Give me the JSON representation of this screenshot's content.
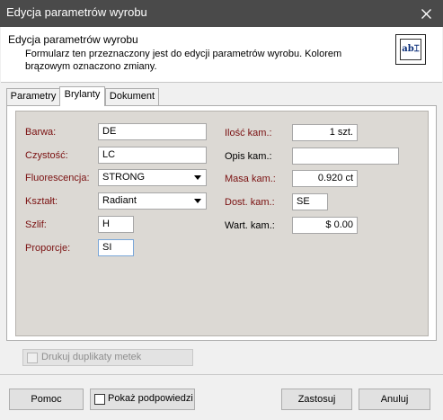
{
  "window": {
    "title": "Edycja parametrów wyrobu"
  },
  "header": {
    "title": "Edycja parametrów wyrobu",
    "description": "Formularz ten przeznaczony jest do edycji parametrów wyrobu. Kolorem brązowym oznaczono zmiany.",
    "icon": "edit-field-icon",
    "icon_text": "ab"
  },
  "tabs": [
    {
      "label": "Parametry",
      "active": false
    },
    {
      "label": "Brylanty",
      "active": true
    },
    {
      "label": "Dokument",
      "active": false
    }
  ],
  "left_fields": [
    {
      "label": "Barwa:",
      "value": "DE"
    },
    {
      "label": "Czystość:",
      "value": "LC"
    },
    {
      "label": "Fluorescencja:",
      "value": "STRONG"
    },
    {
      "label": "Kształt:",
      "value": "Radiant"
    },
    {
      "label": "Szlif:",
      "value": "H"
    },
    {
      "label": "Proporcje:",
      "value": "SI"
    }
  ],
  "right_fields": [
    {
      "label": "Ilość kam.:",
      "value": "1 szt."
    },
    {
      "label": "Opis kam.:",
      "value": ""
    },
    {
      "label": "Masa kam.:",
      "value": "0.920 ct"
    },
    {
      "label": "Dost. kam.:",
      "value": "SE"
    },
    {
      "label": "Wart. kam.:",
      "value": "$ 0.00"
    }
  ],
  "print_duplicates": {
    "label": "Drukuj duplikaty metek",
    "checked": false,
    "enabled": false
  },
  "footer": {
    "help": "Pomoc",
    "show_hints": "Pokaż podpowiedzi",
    "apply": "Zastosuj",
    "cancel": "Anuluj"
  },
  "colors": {
    "changed_label": "#7a1010",
    "titlebar": "#4a4a4a",
    "panel_background": "#dcd9d4"
  }
}
